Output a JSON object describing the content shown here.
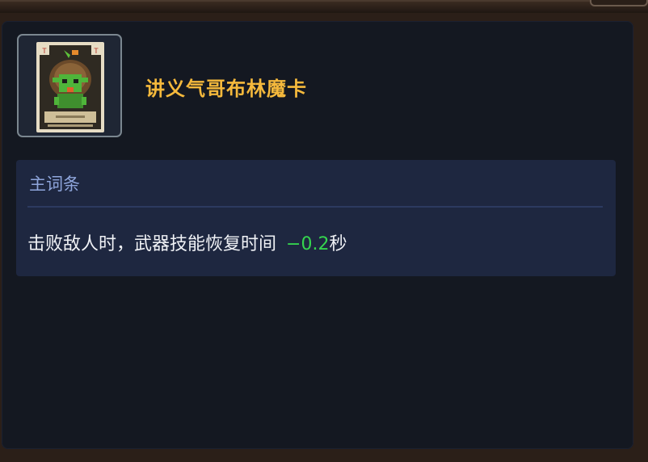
{
  "card": {
    "name": "讲义气哥布林魔卡",
    "icon": "goblin-card-icon",
    "name_color": "#f5b93c"
  },
  "affix": {
    "header": "主词条",
    "description": "击败敌人时，武器技能恢复时间",
    "value": "−0.2",
    "unit": "秒",
    "value_color": "#35d64e"
  }
}
